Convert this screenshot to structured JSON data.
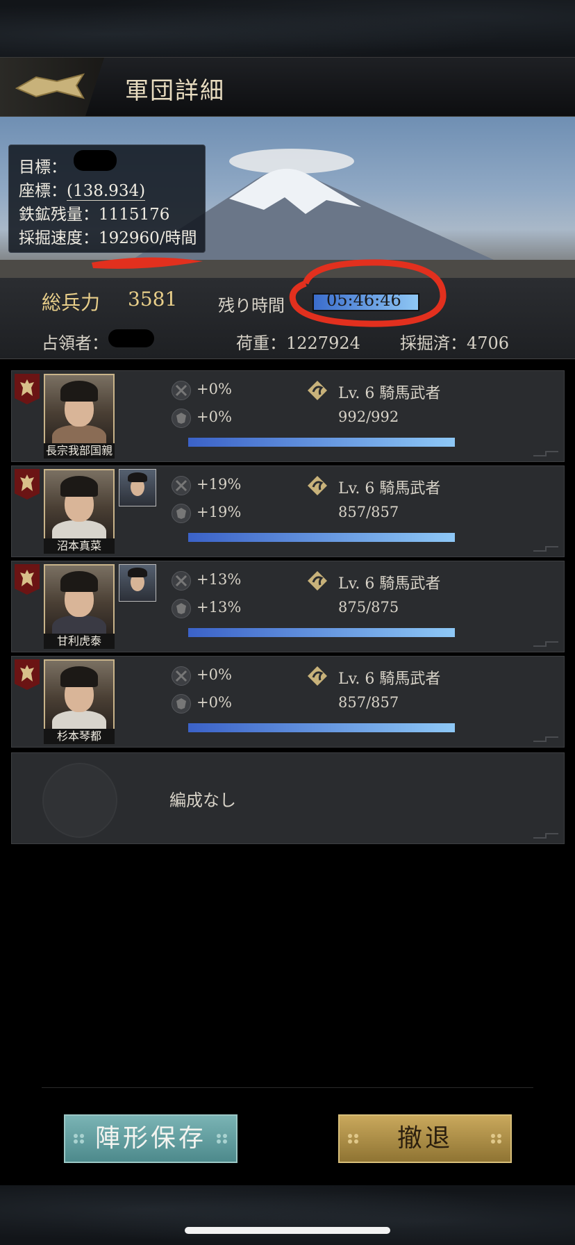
{
  "header": {
    "title": "軍団詳細"
  },
  "target": {
    "target_label": "目標：",
    "coords_label": "座標：",
    "coords_value": "(138.934)",
    "ore_label": "鉄鉱残量：",
    "ore_value": "1115176",
    "speed_label": "採掘速度：",
    "speed_value": "192960/時間"
  },
  "stats": {
    "troops_label": "総兵力",
    "troops_value": "3581",
    "remaining_label": "残り時間",
    "remaining_value": "05:46:46",
    "occupier_label": "占領者：",
    "load_label": "荷重：",
    "load_value": "1227924",
    "mined_label": "採掘済：",
    "mined_value": "4706"
  },
  "units": [
    {
      "name": "長宗我部国親",
      "atk": "+0%",
      "def": "+0%",
      "unit": "Lv. 6 騎馬武者",
      "troops": "992/992",
      "has_vice": false
    },
    {
      "name": "沼本真菜",
      "atk": "+19%",
      "def": "+19%",
      "unit": "Lv. 6 騎馬武者",
      "troops": "857/857",
      "has_vice": true
    },
    {
      "name": "甘利虎泰",
      "atk": "+13%",
      "def": "+13%",
      "unit": "Lv. 6 騎馬武者",
      "troops": "875/875",
      "has_vice": true
    },
    {
      "name": "杉本琴都",
      "atk": "+0%",
      "def": "+0%",
      "unit": "Lv. 6 騎馬武者",
      "troops": "857/857",
      "has_vice": false
    }
  ],
  "empty_slot": {
    "label": "編成なし"
  },
  "buttons": {
    "save": "陣形保存",
    "retreat": "撤退"
  },
  "colors": {
    "gold": "#e9cf8a",
    "bar_start": "#3b62c8",
    "bar_end": "#8ec8f6",
    "badge": "#6b1414"
  }
}
